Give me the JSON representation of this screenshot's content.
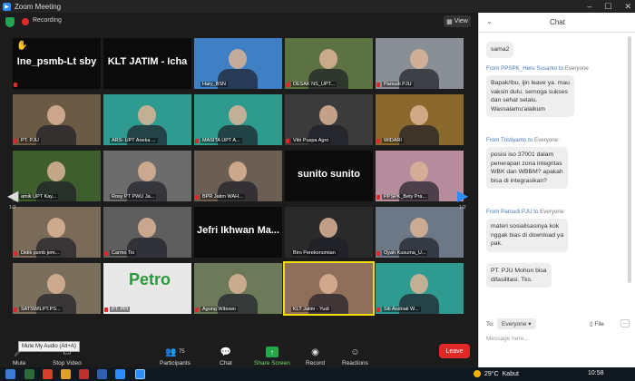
{
  "window": {
    "title": "Zoom Meeting"
  },
  "meeting": {
    "recording_label": "Recording",
    "view_label": "View",
    "page_left": "1/2",
    "page_right": "1/2",
    "tiles": [
      {
        "name": "",
        "big": "Ine_psmb-Lt sby",
        "bg": "#0b0b0b",
        "mic_off": true
      },
      {
        "name": "",
        "big": "KLT JATIM - Icha",
        "bg": "#0b0b0b",
        "mic_off": false
      },
      {
        "name": "Hary_BSN",
        "big": "",
        "bg": "#3f7fc4",
        "mic_off": false
      },
      {
        "name": "DESAK NS_UPT...",
        "big": "",
        "bg": "#5d7242",
        "mic_off": true
      },
      {
        "name": "Parsudi PJU",
        "big": "",
        "bg": "#8a8f95",
        "mic_off": true
      },
      {
        "name": "PT. PJU",
        "big": "",
        "bg": "#6b5a44",
        "mic_off": true
      },
      {
        "name": "ARS- UPT Aneka ...",
        "big": "",
        "bg": "#2f9a8f",
        "mic_off": false
      },
      {
        "name": "MASITA UPT A...",
        "big": "",
        "bg": "#2c9a8c",
        "mic_off": true
      },
      {
        "name": "Vitri Puspa Agro",
        "big": "",
        "bg": "#3b3b3b",
        "mic_off": true
      },
      {
        "name": "WIDARI",
        "big": "",
        "bg": "#8a6a2c",
        "mic_off": true
      },
      {
        "name": "amik UPT Kay...",
        "big": "",
        "bg": "#3e5e2e",
        "mic_off": false
      },
      {
        "name": "Rosy PT PWU Ja...",
        "big": "",
        "bg": "#6c6c6c",
        "mic_off": false
      },
      {
        "name": "BPR Jatim WAH...",
        "big": "",
        "bg": "#6a5f52",
        "mic_off": true
      },
      {
        "name": "",
        "big": "sunito sunito",
        "bg": "#0b0b0b",
        "mic_off": false
      },
      {
        "name": "PPSPK_Bety Pra...",
        "big": "",
        "bg": "#b78c9c",
        "mic_off": true
      },
      {
        "name": "Didik psmb jem...",
        "big": "",
        "bg": "#7a6a58",
        "mic_off": true
      },
      {
        "name": "Carmo Tio",
        "big": "",
        "bg": "#5e5e5e",
        "mic_off": true
      },
      {
        "name": "",
        "big": "Jefri Ikhwan Ma...",
        "bg": "#0b0b0b",
        "mic_off": false
      },
      {
        "name": "Biro Perekonomian",
        "big": "",
        "bg": "#2a2a2a",
        "mic_off": false
      },
      {
        "name": "Oyah Kusuma_U...",
        "big": "",
        "bg": "#6c7886",
        "mic_off": true
      },
      {
        "name": "SATSWILPT.PS...",
        "big": "",
        "bg": "#7a6e5c",
        "mic_off": true
      },
      {
        "name": "PT. PPI",
        "big": "",
        "bg": "#e8e8e8",
        "mic_off": true
      },
      {
        "name": "Agung Wibowo",
        "big": "",
        "bg": "#6c7a5a",
        "mic_off": true
      },
      {
        "name": "KLT Jatim - Yudi",
        "big": "",
        "bg": "#8f6e5a",
        "mic_off": false
      },
      {
        "name": "Siti Andriati W...",
        "big": "",
        "bg": "#2f9a8f",
        "mic_off": true
      }
    ],
    "ppi_logo_text": "Petro"
  },
  "toolbar": {
    "mute_label": "Mute",
    "stop_video_label": "Stop Video",
    "participants_label": "Participants",
    "participants_count": "75",
    "chat_label": "Chat",
    "share_label": "Share Screen",
    "record_label": "Record",
    "reactions_label": "Reactions",
    "leave_label": "Leave",
    "tooltip": "Mute My Audio (Alt+A)"
  },
  "chat": {
    "title": "Chat",
    "messages": [
      {
        "sender": "",
        "to": "",
        "text": "sama2"
      },
      {
        "sender": "From PPSPK_Heru Susanto",
        "to": "Everyone",
        "text": "Bapak/Ibu. ijin leave ya. mau\nvaksin dulu. semoga sukses\ndan sehat selalu.\nWassalamu'alaikum"
      },
      {
        "sender": "From Tristiyanto",
        "to": "Everyone:",
        "text": "posisi iso 37001 dalam\npenerapan zona integritas\nWBK dan WBBM? apakah\nbisa di integrasikan?"
      },
      {
        "sender": "From Parsudi PJU",
        "to": "Everyone:",
        "text": "materi sosialisasinya kok\nnggak bias di download ya\npak."
      },
      {
        "sender": "",
        "to": "",
        "text": "PT. PJU Mohon bisa\ndifasilitasi. Tks."
      }
    ],
    "to_label": "To:",
    "to_value": "Everyone",
    "file_label": "File",
    "input_placeholder": "Message here..."
  },
  "taskbar": {
    "temperature": "29°C",
    "weather": "Kabut",
    "time": "10:58"
  }
}
